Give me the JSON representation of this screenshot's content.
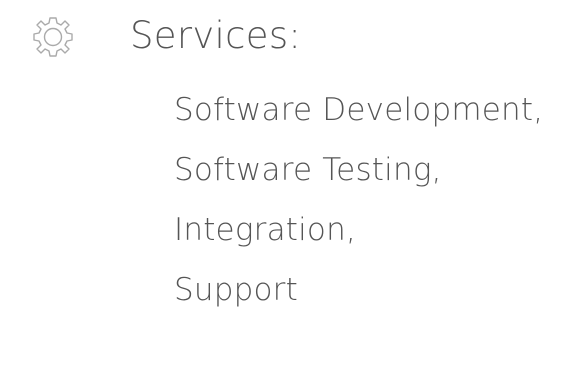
{
  "icon": {
    "name": "gear-icon",
    "color": "#aaaaaa"
  },
  "heading": "Services:",
  "services": [
    {
      "label": "Software Development,"
    },
    {
      "label": "Software Testing,"
    },
    {
      "label": "Integration,"
    },
    {
      "label": "Support"
    }
  ],
  "colors": {
    "text": "#555555",
    "icon": "#aaaaaa"
  }
}
